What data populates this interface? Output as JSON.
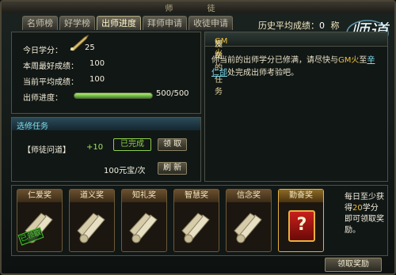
{
  "window": {
    "title": "师 徒"
  },
  "tabs": [
    "名师榜",
    "好学榜",
    "出师进度",
    "拜师申请",
    "收徒申请"
  ],
  "active_tab": 2,
  "avg": {
    "label": "历史平均成绩：",
    "value": "0",
    "extra": "称"
  },
  "logo": "师道",
  "stats": {
    "today_label": "今日学分：",
    "today_value": "25",
    "best_label": "本周最好成绩：",
    "best_value": "100",
    "current_label": "当前平均成绩：",
    "current_value": "100",
    "progress_label": "出师进度：",
    "progress_text": "500/500",
    "progress_fraction": 1.0
  },
  "elective": {
    "header": "选修任务",
    "task_name": "【师徒问道】",
    "task_points": "+10",
    "done_label": "已完成",
    "claim_label": "领 取",
    "price": "100元宝/次",
    "refresh_label": "刷 新"
  },
  "master_task": {
    "header_pre": "师父",
    "header_gm": "GM火",
    "header_post": "发布的任务",
    "text_pre": "你当前的出师学分已修满，请尽快与",
    "text_gm": "GM火",
    "text_mid": "至",
    "text_link": "辛仁郃",
    "text_post": "处完成出师考验吧。"
  },
  "rewards": [
    {
      "label": "仁爱奖",
      "stamp": "已领取"
    },
    {
      "label": "道义奖"
    },
    {
      "label": "知礼奖"
    },
    {
      "label": "智慧奖"
    },
    {
      "label": "信念奖"
    },
    {
      "label": "勤奋奖",
      "mystery": "?"
    }
  ],
  "hint": {
    "pre": "每日至少获得",
    "num": "20",
    "post": "学分即可领取奖励。"
  },
  "claim_reward_button": "领取奖励",
  "colors": {
    "accent": "#f0c040",
    "link": "#7ddcf0",
    "progress": "#9ee860"
  }
}
